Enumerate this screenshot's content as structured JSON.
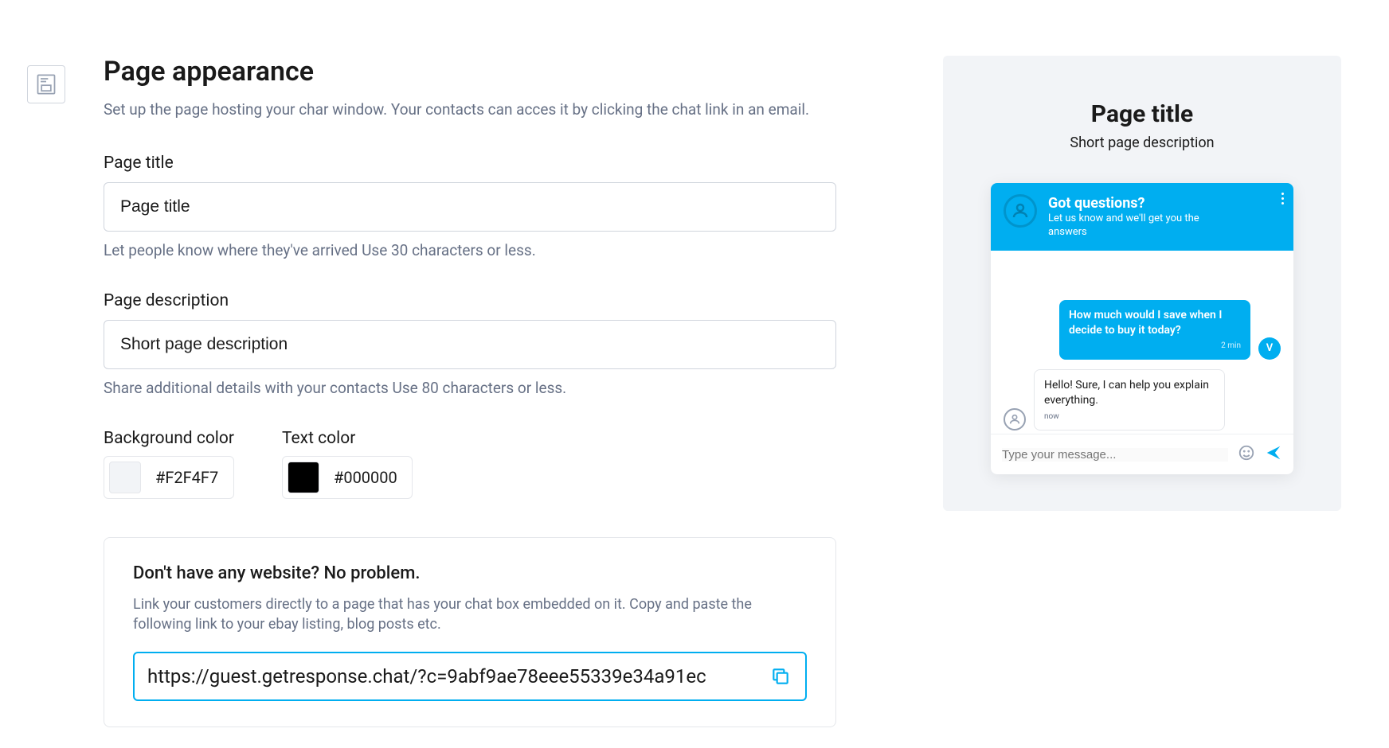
{
  "heading": "Page appearance",
  "subheading": "Set up the page hosting your char window. Your contacts can acces it by clicking the chat link in an email.",
  "fields": {
    "page_title": {
      "label": "Page title",
      "value": "Page title",
      "hint": "Let people know where they've arrived Use 30 characters or less."
    },
    "page_description": {
      "label": "Page description",
      "value": "Short page description",
      "hint": "Share additional details with your contacts Use 80 characters or less."
    },
    "background_color": {
      "label": "Background color",
      "hex": "#F2F4F7"
    },
    "text_color": {
      "label": "Text color",
      "hex": "#000000"
    }
  },
  "link_section": {
    "title": "Don't have any website? No problem.",
    "description": "Link your customers directly to a page that has your chat box embedded on it. Copy and paste the following link to your ebay listing, blog posts etc.",
    "url": "https://guest.getresponse.chat/?c=9abf9ae78eee55339e34a91ec"
  },
  "preview": {
    "title": "Page title",
    "description": "Short page description",
    "chat": {
      "header_title": "Got questions?",
      "header_subtitle": "Let us know and we'll get you the answers",
      "messages": [
        {
          "side": "sent",
          "text": "How much would I save when I decide to buy it today?",
          "time": "2 min",
          "avatar_initial": "V"
        },
        {
          "side": "recv",
          "text": "Hello! Sure, I can help you explain everything.",
          "time": "now"
        }
      ],
      "input_placeholder": "Type your message..."
    }
  }
}
